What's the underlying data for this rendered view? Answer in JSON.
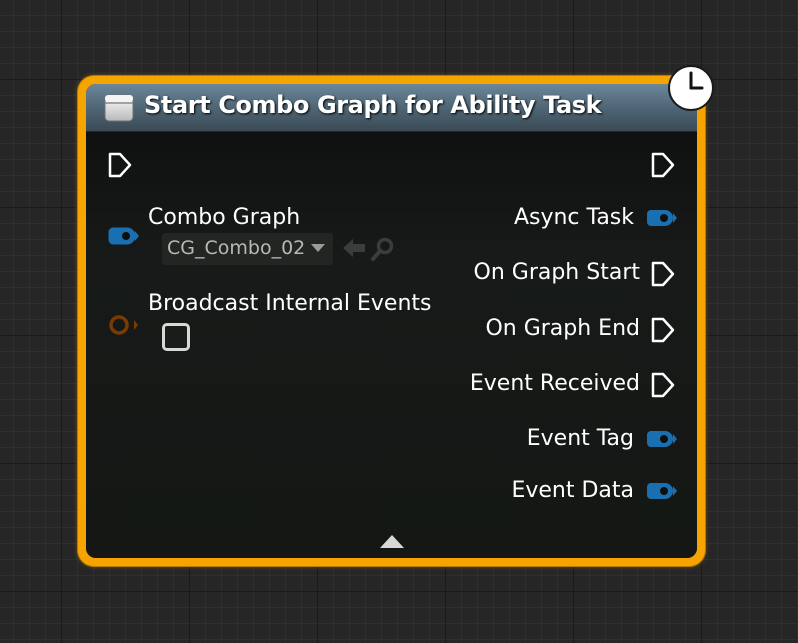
{
  "node": {
    "title": "Start Combo Graph for Ability Task",
    "header_icon": "function-icon",
    "latent_icon": "clock-icon",
    "accent_color": "#f5a400",
    "header_color": "#5a7384"
  },
  "inputs": {
    "exec": {
      "icon": "exec-pin-icon"
    },
    "combo_graph": {
      "label": "Combo Graph",
      "value": "CG_Combo_02",
      "pin_color": "#1a6fb0",
      "use_asset_icon": "arrow-left-icon",
      "browse_icon": "search-icon"
    },
    "broadcast_internal_events": {
      "label": "Broadcast Internal Events",
      "checked": false,
      "pin_color": "#7a3a00"
    }
  },
  "outputs": {
    "exec": {
      "icon": "exec-pin-icon"
    },
    "async_task": {
      "label": "Async Task",
      "pin_color": "#1a6fb0"
    },
    "on_graph_start": {
      "label": "On Graph Start"
    },
    "on_graph_end": {
      "label": "On Graph End"
    },
    "event_received": {
      "label": "Event Received"
    },
    "event_tag": {
      "label": "Event Tag",
      "pin_color": "#1a6fb0"
    },
    "event_data": {
      "label": "Event Data",
      "pin_color": "#1a6fb0"
    }
  },
  "footer": {
    "advanced_toggle_icon": "chevron-up-icon"
  }
}
